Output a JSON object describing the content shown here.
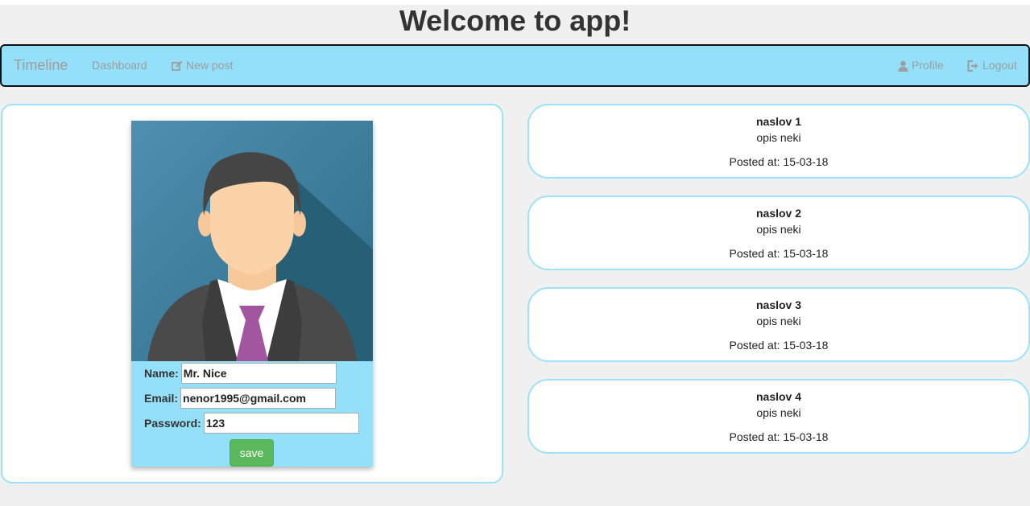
{
  "header": {
    "title": "Welcome to app!"
  },
  "navbar": {
    "brand": "Timeline",
    "dashboard": "Dashboard",
    "new_post": "New post",
    "profile": "Profile",
    "logout": "Logout"
  },
  "profile": {
    "name_label": "Name:",
    "name_value": "Mr. Nice",
    "email_label": "Email:",
    "email_value": "nenor1995@gmail.com",
    "password_label": "Password:",
    "password_value": "123",
    "save_label": "save"
  },
  "posts": [
    {
      "title": "naslov 1",
      "description": "opis neki",
      "posted_at": "Posted at: 15-03-18"
    },
    {
      "title": "naslov 2",
      "description": "opis neki",
      "posted_at": "Posted at: 15-03-18"
    },
    {
      "title": "naslov 3",
      "description": "opis neki",
      "posted_at": "Posted at: 15-03-18"
    },
    {
      "title": "naslov 4",
      "description": "opis neki",
      "posted_at": "Posted at: 15-03-18"
    }
  ],
  "colors": {
    "navbar_bg": "#94e0fb",
    "card_border": "#9ce2f8",
    "save_button": "#5cb85c",
    "nav_text": "#9d9d9d"
  },
  "icons": {
    "new_post": "edit-icon",
    "profile": "user-icon",
    "logout": "logout-icon"
  }
}
